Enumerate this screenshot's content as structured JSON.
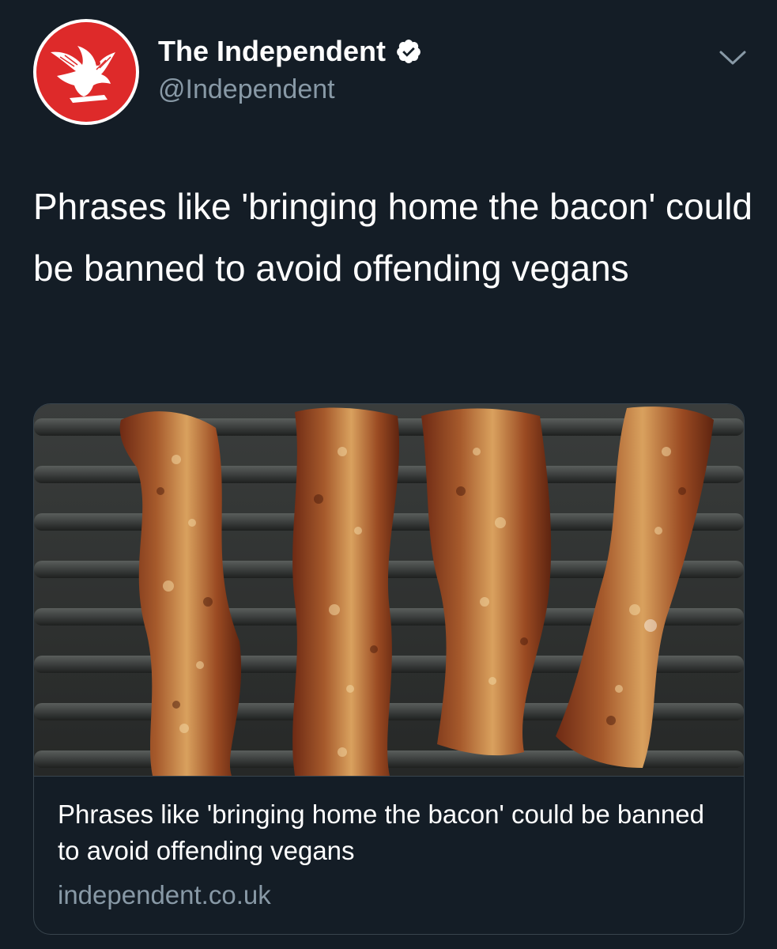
{
  "account": {
    "display_name": "The Independent",
    "handle": "@Independent",
    "verified": true,
    "avatar_icon": "independent-eagle-logo",
    "avatar_color": "#de2a2a"
  },
  "tweet": {
    "text": "Phrases like 'bringing home the bacon' could be banned to avoid offending vegans"
  },
  "card": {
    "image_description_icon": "bacon-photo",
    "title": "Phrases like 'bringing home the bacon' could be banned to avoid offending vegans",
    "domain": "independent.co.uk"
  },
  "menu": {
    "icon": "chevron-down-icon"
  },
  "colors": {
    "background": "#141d26",
    "secondary_text": "#8899a6",
    "border": "#38444d"
  }
}
